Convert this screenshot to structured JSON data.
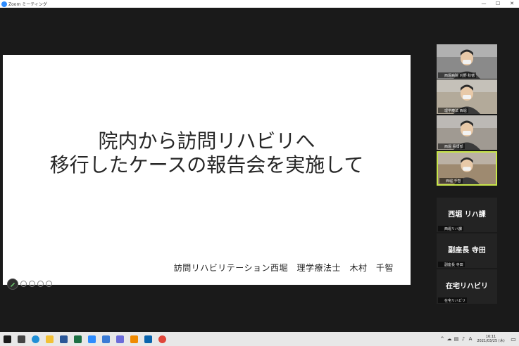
{
  "window": {
    "title": "Zoom ミーティング",
    "minimize": "—",
    "maximize": "☐",
    "close": "✕"
  },
  "slide": {
    "title_line1": "院内から訪問リハビリへ",
    "title_line2": "移行したケースの報告会を実施して",
    "credit": "訪問リハビリテーション西堀　理学療法士　木村　千智"
  },
  "participants": [
    {
      "label": "西堀病院 刈野 秋徳",
      "center_name": "",
      "video": true,
      "active": false
    },
    {
      "label": "理学療法 西堀",
      "center_name": "",
      "video": true,
      "active": false
    },
    {
      "label": "西堀 看護部",
      "center_name": "",
      "video": true,
      "active": false
    },
    {
      "label": "西堀 千智",
      "center_name": "",
      "video": true,
      "active": true
    },
    {
      "label": "西堀リハ課",
      "center_name": "西堀 リハ課",
      "video": false,
      "active": false
    },
    {
      "label": "副座長 寺田",
      "center_name": "副座長 寺田",
      "video": false,
      "active": false
    },
    {
      "label": "在宅リハビリ",
      "center_name": "在宅リハビリ",
      "video": false,
      "active": false
    }
  ],
  "taskbar": {
    "apps": [
      "windows-start",
      "task-view",
      "edge",
      "file-explorer",
      "word",
      "excel",
      "zoom",
      "app-blue",
      "app-chrome-like",
      "vlc",
      "outlook",
      "chrome"
    ],
    "clock_time": "16:11",
    "clock_date": "2021/03/25 (木)",
    "ime": "A"
  },
  "colors": {
    "active_speaker": "#c8e64a",
    "zoom_blue": "#2d8cff",
    "mic_muted": "#e0342b"
  }
}
